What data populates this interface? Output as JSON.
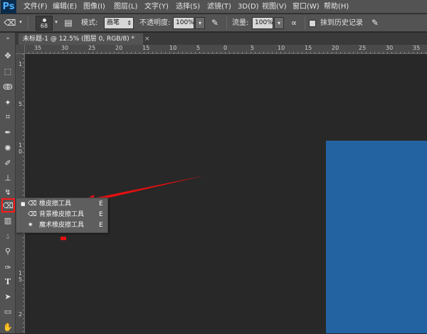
{
  "app": {
    "logo": "Ps"
  },
  "menu": [
    "文件(F)",
    "编辑(E)",
    "图像(I)",
    "图层(L)",
    "文字(Y)",
    "选择(S)",
    "滤镜(T)",
    "3D(D)",
    "视图(V)",
    "窗口(W)",
    "帮助(H)"
  ],
  "options": {
    "brush_size": "68",
    "mode_label": "模式:",
    "mode_value": "画笔",
    "opacity_label": "不透明度:",
    "opacity_value": "100%",
    "flow_label": "流量:",
    "flow_value": "100%",
    "erase_history_label": "抹到历史记录"
  },
  "document": {
    "tab_title": "未标题-1 @ 12.5% (图层 0, RGB/8) *",
    "close": "×"
  },
  "rulers": {
    "top": [
      "35",
      "30",
      "25",
      "20",
      "15",
      "10",
      "5",
      "0",
      "5",
      "10",
      "15",
      "20",
      "25",
      "30",
      "35"
    ],
    "left": [
      "1",
      "5",
      "1\n0",
      "1\n5",
      "2"
    ]
  },
  "flyout": {
    "items": [
      {
        "label": "橡皮擦工具",
        "shortcut": "E",
        "active": true
      },
      {
        "label": "背景橡皮擦工具",
        "shortcut": "E",
        "active": false
      },
      {
        "label": "魔术橡皮擦工具",
        "shortcut": "E",
        "active": false
      }
    ]
  },
  "colors": {
    "accent_blue": "#2463a2",
    "annotation_red": "#e21010"
  }
}
